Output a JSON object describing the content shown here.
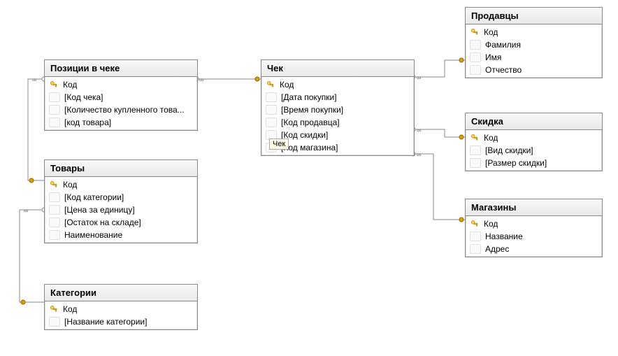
{
  "tooltip": "Чек",
  "tables": {
    "positions": {
      "title": "Позиции в чеке",
      "fields": [
        {
          "pk": true,
          "label": "Код"
        },
        {
          "pk": false,
          "label": "[Код чека]"
        },
        {
          "pk": false,
          "label": "[Количество купленного това..."
        },
        {
          "pk": false,
          "label": "[код товара]"
        }
      ]
    },
    "goods": {
      "title": "Товары",
      "fields": [
        {
          "pk": true,
          "label": "Код"
        },
        {
          "pk": false,
          "label": "[Код категории]"
        },
        {
          "pk": false,
          "label": "[Цена за единицу]"
        },
        {
          "pk": false,
          "label": "[Остаток на складе]"
        },
        {
          "pk": false,
          "label": "Наименование"
        }
      ]
    },
    "categories": {
      "title": "Категории",
      "fields": [
        {
          "pk": true,
          "label": "Код"
        },
        {
          "pk": false,
          "label": "[Название категории]"
        }
      ]
    },
    "cheque": {
      "title": "Чек",
      "fields": [
        {
          "pk": true,
          "label": "Код"
        },
        {
          "pk": false,
          "label": "[Дата покупки]"
        },
        {
          "pk": false,
          "label": "[Время покупки]"
        },
        {
          "pk": false,
          "label": "[Код продавца]"
        },
        {
          "pk": false,
          "label": "[Код скидки]"
        },
        {
          "pk": false,
          "label": "[Код магазина]"
        }
      ]
    },
    "sellers": {
      "title": "Продавцы",
      "fields": [
        {
          "pk": true,
          "label": "Код"
        },
        {
          "pk": false,
          "label": "Фамилия"
        },
        {
          "pk": false,
          "label": "Имя"
        },
        {
          "pk": false,
          "label": "Отчество"
        }
      ]
    },
    "discount": {
      "title": "Скидка",
      "fields": [
        {
          "pk": true,
          "label": "Код"
        },
        {
          "pk": false,
          "label": "[Вид скидки]"
        },
        {
          "pk": false,
          "label": "[Размер скидки]"
        }
      ]
    },
    "shops": {
      "title": "Магазины",
      "fields": [
        {
          "pk": true,
          "label": "Код"
        },
        {
          "pk": false,
          "label": "Название"
        },
        {
          "pk": false,
          "label": "Адрес"
        }
      ]
    }
  },
  "relations": [
    {
      "from": "positions",
      "to": "cheque"
    },
    {
      "from": "positions",
      "to": "goods"
    },
    {
      "from": "goods",
      "to": "categories"
    },
    {
      "from": "cheque",
      "to": "sellers"
    },
    {
      "from": "cheque",
      "to": "discount"
    },
    {
      "from": "cheque",
      "to": "shops"
    }
  ]
}
